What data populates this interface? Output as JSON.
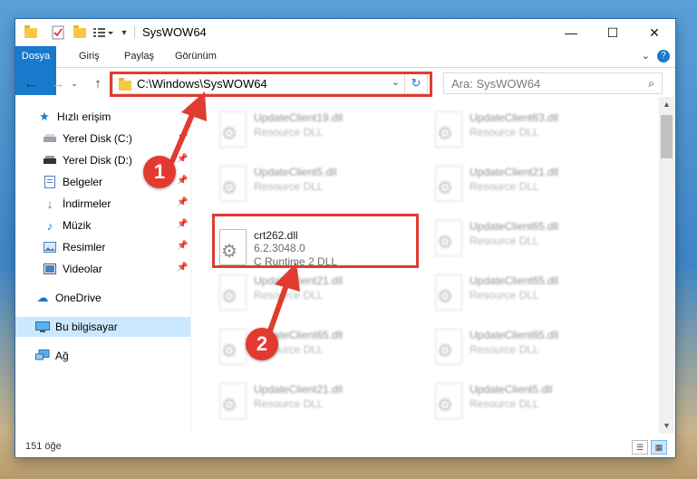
{
  "window": {
    "title": "SysWOW64",
    "controls": {
      "minimize": "—",
      "maximize": "☐",
      "close": "✕"
    }
  },
  "ribbon": {
    "tabs": [
      "Dosya",
      "Giriş",
      "Paylaş",
      "Görünüm"
    ],
    "help": "?"
  },
  "address": {
    "path": "C:\\Windows\\SysWOW64",
    "search_placeholder": "Ara: SysWOW64"
  },
  "sidebar": {
    "items": [
      {
        "label": "Hızlı erişim",
        "icon": "star-icon",
        "pinned": false
      },
      {
        "label": "Yerel Disk (C:)",
        "icon": "drive-icon",
        "pinned": true
      },
      {
        "label": "Yerel Disk (D:)",
        "icon": "drive-icon",
        "pinned": true
      },
      {
        "label": "Belgeler",
        "icon": "document-icon",
        "pinned": true
      },
      {
        "label": "İndirmeler",
        "icon": "download-icon",
        "pinned": true
      },
      {
        "label": "Müzik",
        "icon": "music-icon",
        "pinned": true
      },
      {
        "label": "Resimler",
        "icon": "picture-icon",
        "pinned": true
      },
      {
        "label": "Videolar",
        "icon": "video-icon",
        "pinned": true
      },
      {
        "label": "OneDrive",
        "icon": "cloud-icon",
        "pinned": false
      },
      {
        "label": "Bu bilgisayar",
        "icon": "computer-icon",
        "pinned": false,
        "selected": true
      },
      {
        "label": "Ağ",
        "icon": "network-icon",
        "pinned": false
      }
    ]
  },
  "files": {
    "left_column": [
      {
        "name": "UpdateClient19.dll",
        "desc": "Resource DLL"
      },
      {
        "name": "UpdateClient5.dll",
        "desc": "Resource DLL"
      },
      {
        "name": "UpdateClient21.dll",
        "desc": "Resource DLL"
      },
      {
        "name": "UpdateClient65.dll",
        "desc": "Resource DLL"
      },
      {
        "name": "UpdateClient21.dll",
        "desc": "Resource DLL"
      }
    ],
    "right_column": [
      {
        "name": "UpdateClient63.dll",
        "desc": "Resource DLL"
      },
      {
        "name": "UpdateClient21.dll",
        "desc": "Resource DLL"
      },
      {
        "name": "UpdateClient65.dll",
        "desc": "Resource DLL"
      },
      {
        "name": "UpdateClient65.dll",
        "desc": "Resource DLL"
      },
      {
        "name": "UpdateClient65.dll",
        "desc": "Resource DLL"
      },
      {
        "name": "UpdateClient5.dll",
        "desc": "Resource DLL"
      }
    ],
    "highlighted": {
      "name": "crt262.dll",
      "version": "6.2.3048.0",
      "desc": "C Runtime 2 DLL"
    }
  },
  "status": {
    "count": "151 öğe"
  },
  "annotations": {
    "step1": "1",
    "step2": "2",
    "color": "#e03c31"
  }
}
